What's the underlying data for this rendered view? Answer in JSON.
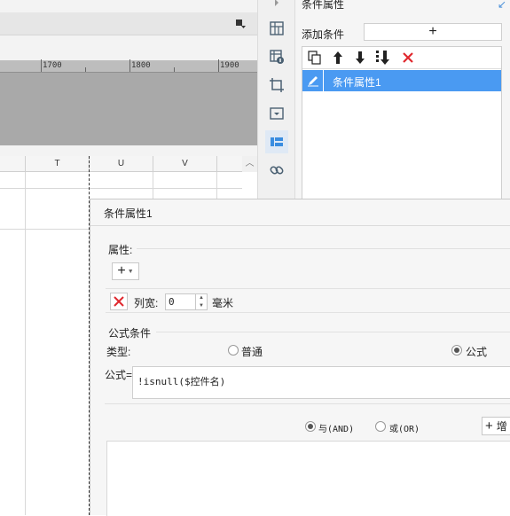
{
  "ruler": {
    "labels": [
      "1700",
      "1800",
      "1900"
    ]
  },
  "sheet": {
    "columns": [
      "T",
      "U",
      "V"
    ]
  },
  "condition_panel": {
    "title": "条件属性",
    "add_condition_label": "添加条件",
    "add_condition_button": "+",
    "items": [
      {
        "label": "条件属性1",
        "selected": true
      }
    ]
  },
  "dialog": {
    "title": "条件属性1",
    "properties_label": "属性:",
    "add_property_button": "+",
    "property_row": {
      "name": "列宽:",
      "value": "0",
      "unit": "毫米"
    },
    "formula_section_label": "公式条件",
    "type_label": "类型:",
    "type_options": [
      {
        "label": "普通",
        "selected": false
      },
      {
        "label": "公式",
        "selected": true
      }
    ],
    "formula_label": "公式=",
    "formula_value": "!isnull($控件名)",
    "logic_options": [
      {
        "label": "与(AND)",
        "selected": true
      },
      {
        "label": "或(OR)",
        "selected": false
      }
    ],
    "add_button_label": "增"
  },
  "colors": {
    "accent": "#4a9af2",
    "delete": "#e0282e",
    "link": "#4a90d9"
  },
  "icons": [
    "toolbar-dropdown-icon",
    "freeze-icon",
    "table-info-icon",
    "crop-icon",
    "widget-icon",
    "condition-icon",
    "link-icon",
    "copy-icon",
    "arrow-up-icon",
    "arrow-down-icon",
    "move-bottom-icon",
    "delete-icon",
    "edit-icon"
  ]
}
